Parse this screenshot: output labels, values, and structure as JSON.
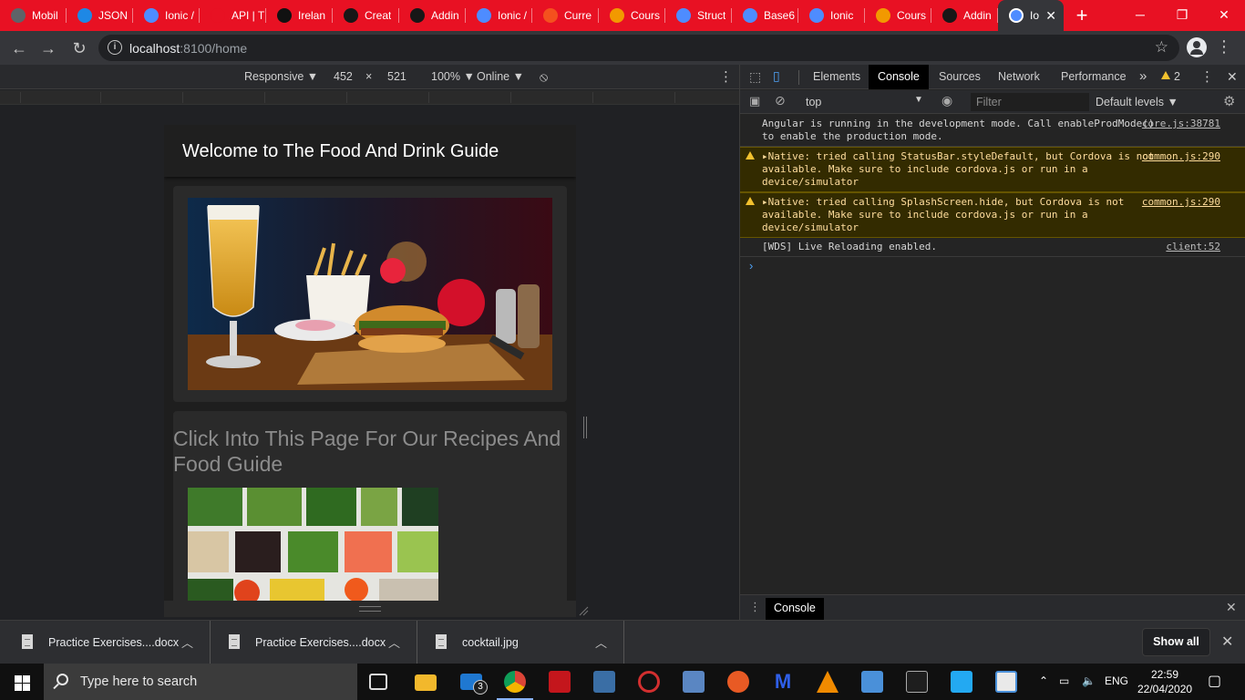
{
  "browser": {
    "tabs": [
      {
        "label": "Mobil",
        "favicon_color": "#5f6368"
      },
      {
        "label": "JSON",
        "favicon_color": "#1e88e5"
      },
      {
        "label": "Ionic /",
        "favicon_color": "#4e8cff"
      },
      {
        "label": "API | T",
        "favicon_color": "#e81123"
      },
      {
        "label": "Irelan",
        "favicon_color": "#111111"
      },
      {
        "label": "Creat",
        "favicon_color": "#181717"
      },
      {
        "label": "Addin",
        "favicon_color": "#181717"
      },
      {
        "label": "Ionic /",
        "favicon_color": "#4e8cff"
      },
      {
        "label": "Curre",
        "favicon_color": "#f4511e"
      },
      {
        "label": "Cours",
        "favicon_color": "#f29900"
      },
      {
        "label": "Struct",
        "favicon_color": "#4e8cff"
      },
      {
        "label": "Base6",
        "favicon_color": "#4e8cff"
      },
      {
        "label": "Ionic",
        "favicon_color": "#4e8cff"
      },
      {
        "label": "Cours",
        "favicon_color": "#f29900"
      },
      {
        "label": "Addin",
        "favicon_color": "#181717"
      }
    ],
    "active_tab": {
      "label": "Io",
      "favicon_color": "#4e8cff"
    },
    "url_host": "localhost",
    "url_rest": ":8100/home",
    "accent": "#e81123"
  },
  "device_toolbar": {
    "mode": "Responsive ▼",
    "width": "452",
    "times": "×",
    "height": "521",
    "zoom": "100% ▼",
    "network": "Online ▼"
  },
  "app": {
    "title": "Welcome to The Food And Drink Guide",
    "card2_heading": "Click Into This Page For Our Recipes And Food Guide"
  },
  "devtools": {
    "tabs": [
      "Elements",
      "Console",
      "Sources",
      "Network",
      "Performance"
    ],
    "active_tab": "Console",
    "more": "»",
    "warnings_count": "2",
    "context": "top",
    "filter_placeholder": "Filter",
    "levels": "Default levels ▼",
    "messages": [
      {
        "level": "info",
        "text": "Angular is running in the development mode. Call enableProdMode() to enable the production mode.",
        "source": "core.js:38781"
      },
      {
        "level": "warning",
        "text": "▸Native: tried calling StatusBar.styleDefault, but Cordova is not available. Make sure to include cordova.js or run in a device/simulator",
        "source": "common.js:290"
      },
      {
        "level": "warning",
        "text": "▸Native: tried calling SplashScreen.hide, but Cordova is not available. Make sure to include cordova.js or run in a device/simulator",
        "source": "common.js:290"
      },
      {
        "level": "info",
        "text": "[WDS] Live Reloading enabled.",
        "source": "client:52"
      }
    ],
    "prompt": "›",
    "drawer_tab": "Console"
  },
  "downloads": {
    "items": [
      {
        "name": "Practice Exercises....docx"
      },
      {
        "name": "Practice Exercises....docx"
      },
      {
        "name": "cocktail.jpg"
      }
    ],
    "show_all": "Show all"
  },
  "taskbar": {
    "search_placeholder": "Type here to search",
    "mail_badge": "3",
    "language": "ENG",
    "time": "22:59",
    "date": "22/04/2020"
  }
}
